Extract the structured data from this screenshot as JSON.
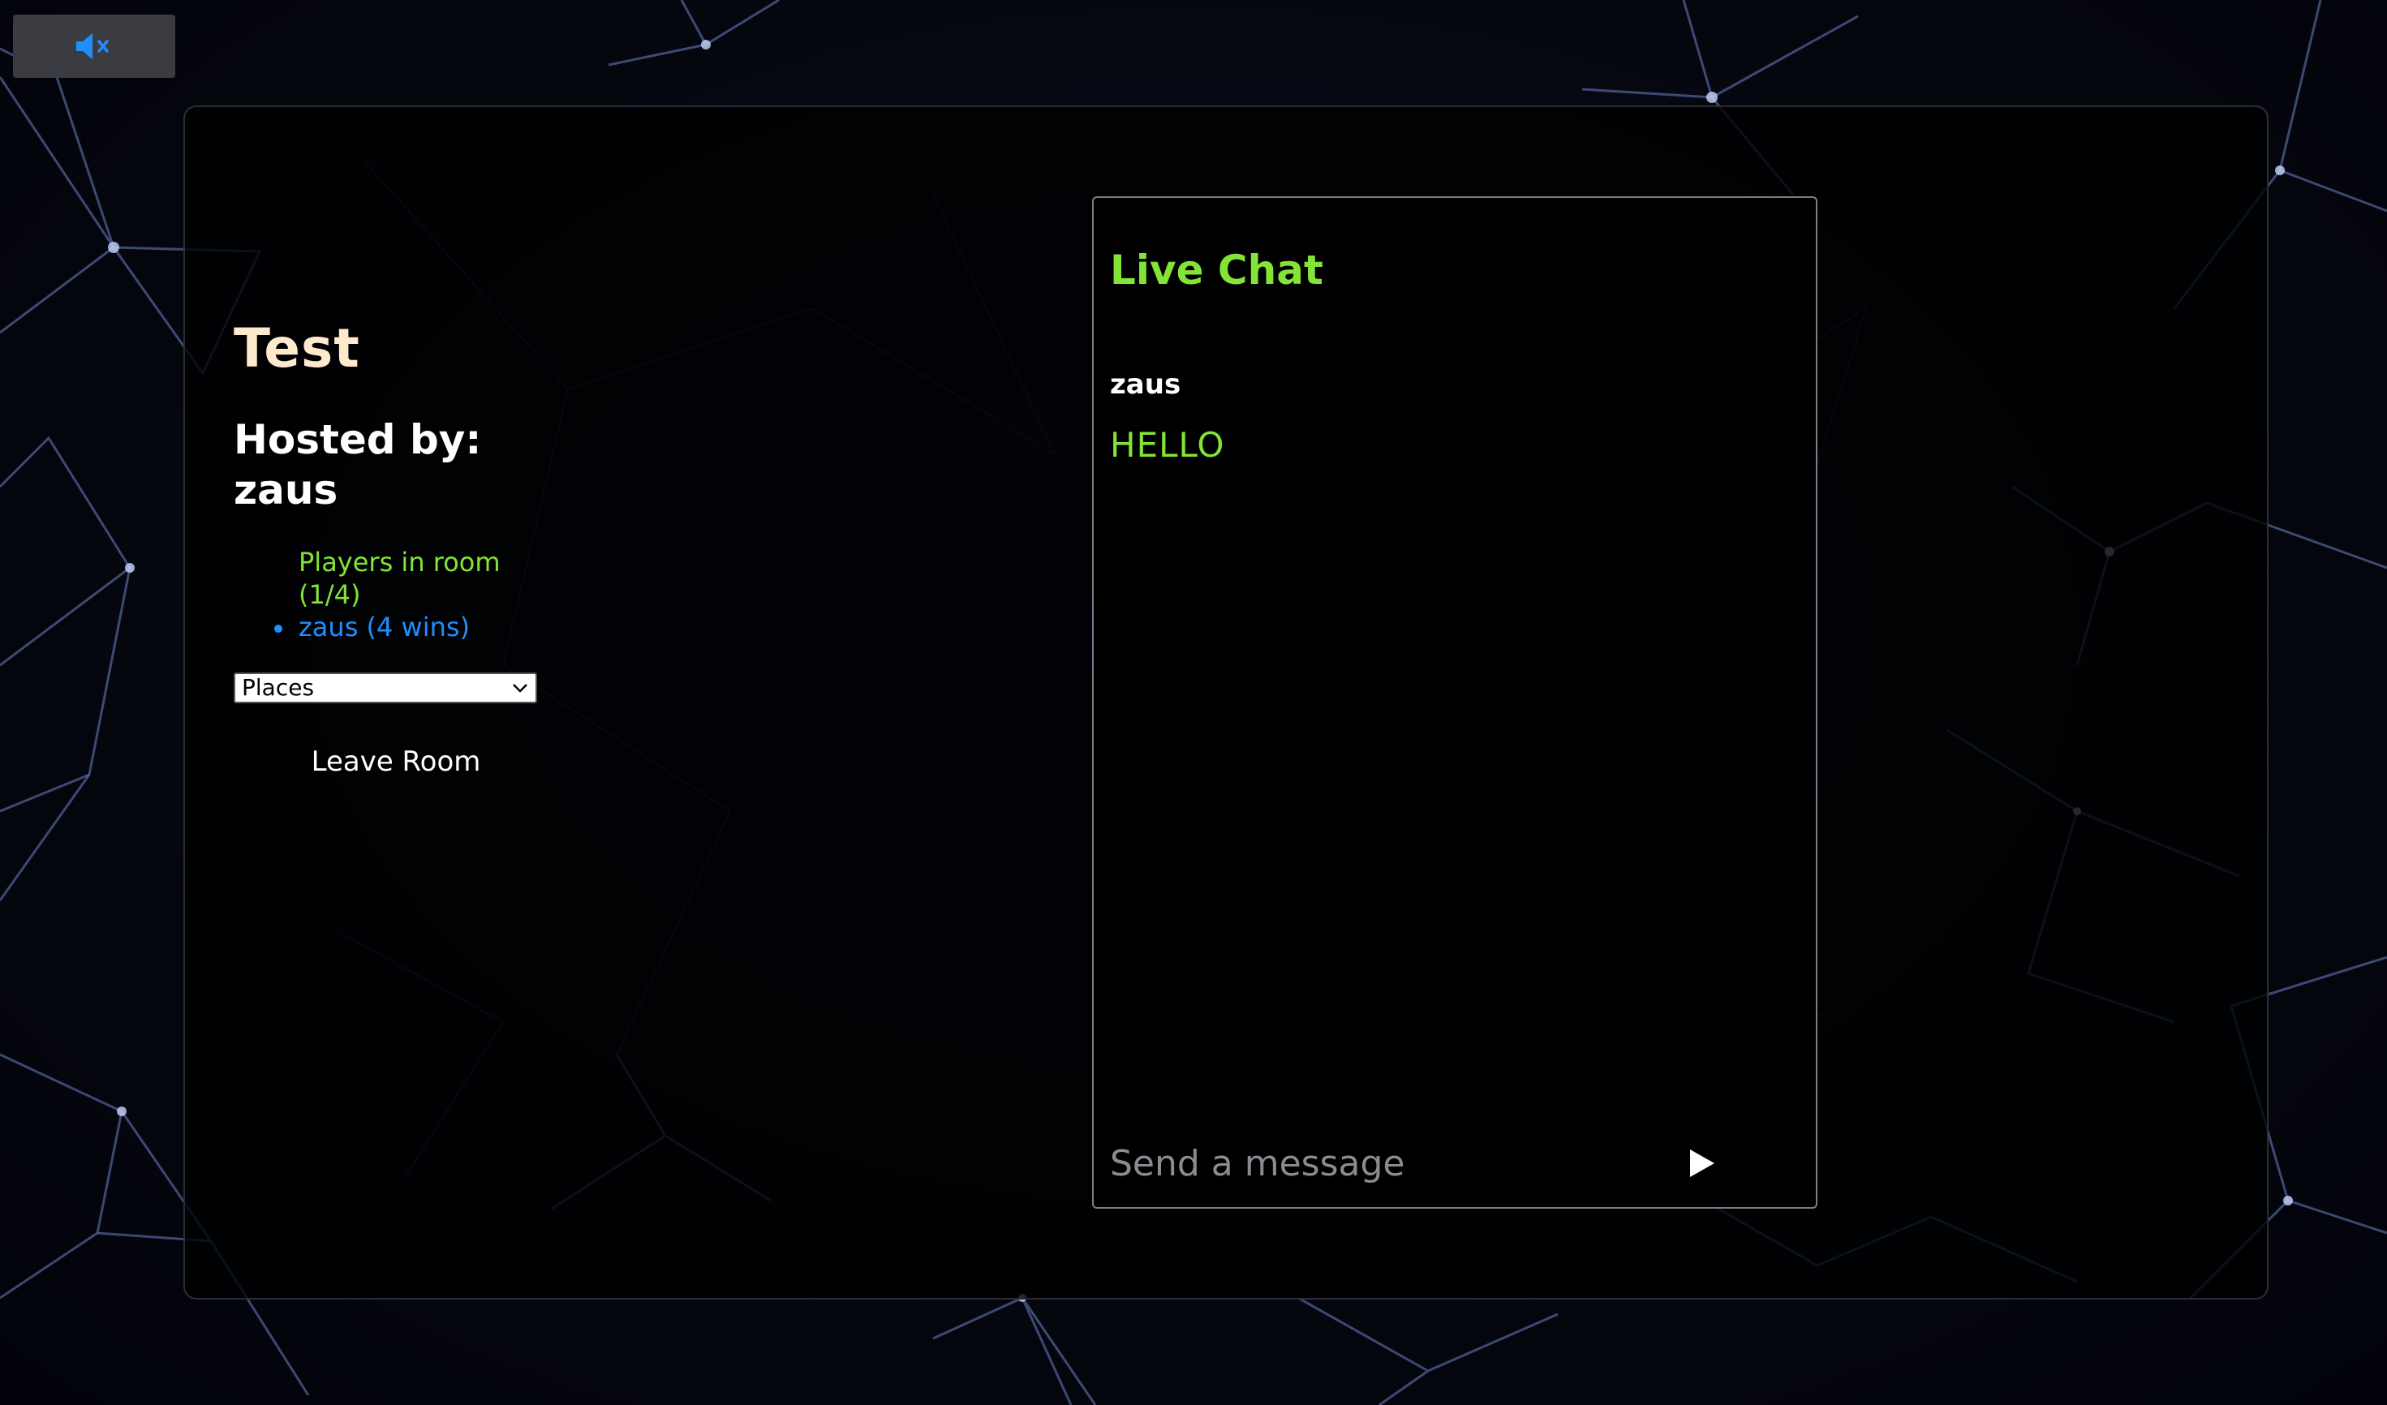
{
  "mute_button": {
    "icon": "speaker-muted-icon",
    "color": "#1f8fff"
  },
  "room": {
    "title": "Test",
    "hosted_by_label": "Hosted by:",
    "host_name": "zaus",
    "players_heading": "Players in room",
    "players_count": "(1/4)",
    "players": [
      "zaus (4 wins)"
    ],
    "category_select": {
      "selected": "Places"
    },
    "leave_label": "Leave Room"
  },
  "chat": {
    "title": "Live Chat",
    "messages": [
      {
        "author": "zaus",
        "text": "HELLO"
      }
    ],
    "input_placeholder": "Send a message",
    "send_icon": "play-triangle-icon"
  },
  "colors": {
    "accent_green": "#84e337",
    "accent_blue": "#1f8fff",
    "title_cream": "#fde9cc"
  }
}
